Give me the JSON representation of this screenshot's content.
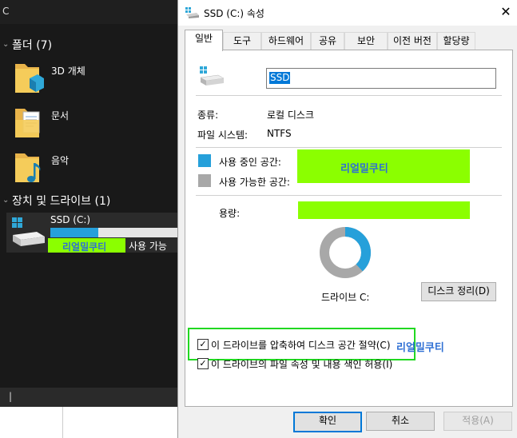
{
  "explorer": {
    "top_letter": "C",
    "group_folders": "폴더 (7)",
    "folders": [
      {
        "label": "3D 개체",
        "icon": "3d-objects-folder-icon"
      },
      {
        "label": "문서",
        "icon": "documents-folder-icon"
      },
      {
        "label": "음악",
        "icon": "music-folder-icon"
      }
    ],
    "group_drives": "장치 및 드라이브 (1)",
    "drive": {
      "name": "SSD (C:)",
      "free_text": "사용 가능",
      "used_fraction": 0.38
    },
    "watermark": "리얼밀쿠티",
    "path_text": "|"
  },
  "dialog": {
    "title": "SSD (C:) 속성",
    "close_glyph": "✕",
    "tabs": [
      "일반",
      "도구",
      "하드웨어",
      "공유",
      "보안",
      "이전 버전",
      "할당량"
    ],
    "name_value": "SSD",
    "type_label": "종류:",
    "type_value": "로컬 디스크",
    "fs_label": "파일 시스템:",
    "fs_value": "NTFS",
    "used_label": "사용 중인 공간:",
    "free_label": "사용 가능한 공간:",
    "capacity_label": "용량:",
    "watermark": "리얼밀쿠티",
    "drive_caption": "드라이브 C:",
    "cleanup_button": "디스크 정리(D)",
    "compress_label": "이 드라이브를 압축하여 디스크 공간 절약(C)",
    "index_label": "이 드라이브의 파일 속성 및 내용 색인 허용(I)",
    "ok_button": "확인",
    "cancel_button": "취소",
    "apply_button": "적용(A)",
    "used_fraction": 0.38,
    "colors": {
      "used": "#26a0da",
      "free": "#a8a8a8",
      "highlight": "#8bff00",
      "focus_box": "#21d821"
    }
  }
}
